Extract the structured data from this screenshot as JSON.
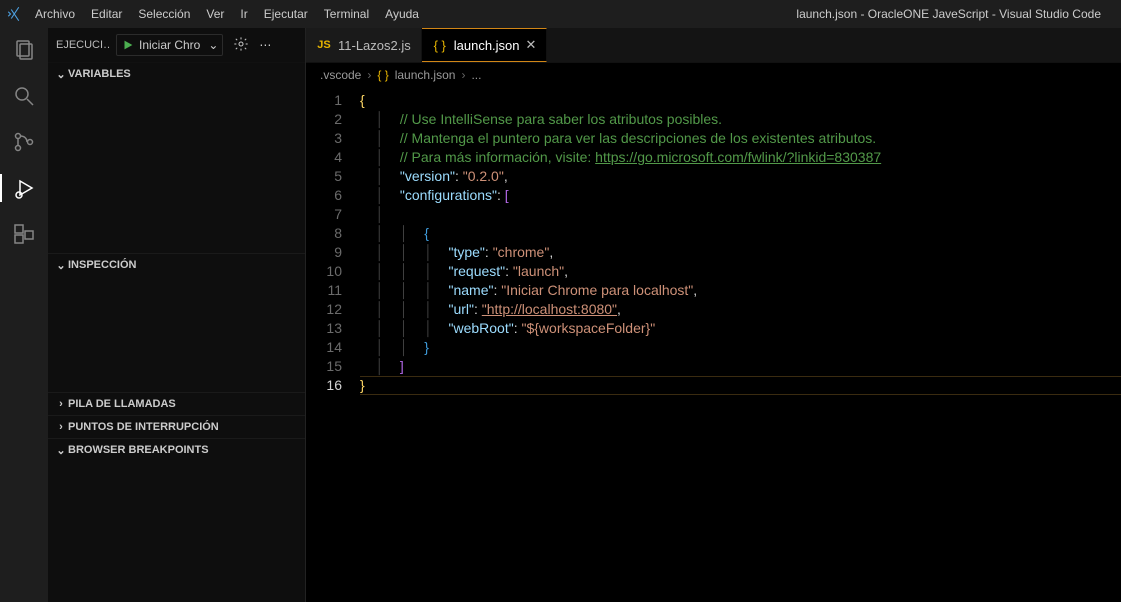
{
  "window": {
    "title": "launch.json - OracleONE JaveScript - Visual Studio Code"
  },
  "menu": {
    "archivo": "Archivo",
    "editar": "Editar",
    "seleccion": "Selección",
    "ver": "Ver",
    "ir": "Ir",
    "ejecutar": "Ejecutar",
    "terminal": "Terminal",
    "ayuda": "Ayuda"
  },
  "sidebar": {
    "header_title": "EJECUCI…",
    "config_name": "Iniciar Chro",
    "sections": {
      "variables": "VARIABLES",
      "inspeccion": "INSPECCIÓN",
      "pila": "PILA DE LLAMADAS",
      "puntos": "PUNTOS DE INTERRUPCIÓN",
      "browser_bp": "BROWSER BREAKPOINTS"
    }
  },
  "tabs": {
    "tab1": {
      "label": "11-Lazos2.js",
      "icon": "JS"
    },
    "tab2": {
      "label": "launch.json",
      "icon": "{ }"
    }
  },
  "breadcrumb": {
    "folder": ".vscode",
    "file": "launch.json",
    "sym_icon": "{ }",
    "trail": "..."
  },
  "code": {
    "l1": "{",
    "l2_cmt": "// Use IntelliSense para saber los atributos posibles.",
    "l3_cmt": "// Mantenga el puntero para ver las descripciones de los existentes atributos.",
    "l4_cmt_a": "// Para más información, visite: ",
    "l4_cmt_b": "https://go.microsoft.com/fwlink/?linkid=830387",
    "l5_k": "\"version\"",
    "l5_v": "\"0.2.0\"",
    "l6_k": "\"configurations\"",
    "l9_k": "\"type\"",
    "l9_v": "\"chrome\"",
    "l10_k": "\"request\"",
    "l10_v": "\"launch\"",
    "l11_k": "\"name\"",
    "l11_v": "\"Iniciar Chrome para localhost\"",
    "l12_k": "\"url\"",
    "l12_v": "\"http://localhost:8080\"",
    "l13_k": "\"webRoot\"",
    "l13_v": "\"${workspaceFolder}\"",
    "l16": "}",
    "current_line": 16
  },
  "line_numbers": [
    "1",
    "2",
    "3",
    "4",
    "5",
    "6",
    "7",
    "8",
    "9",
    "10",
    "11",
    "12",
    "13",
    "14",
    "15",
    "16"
  ]
}
